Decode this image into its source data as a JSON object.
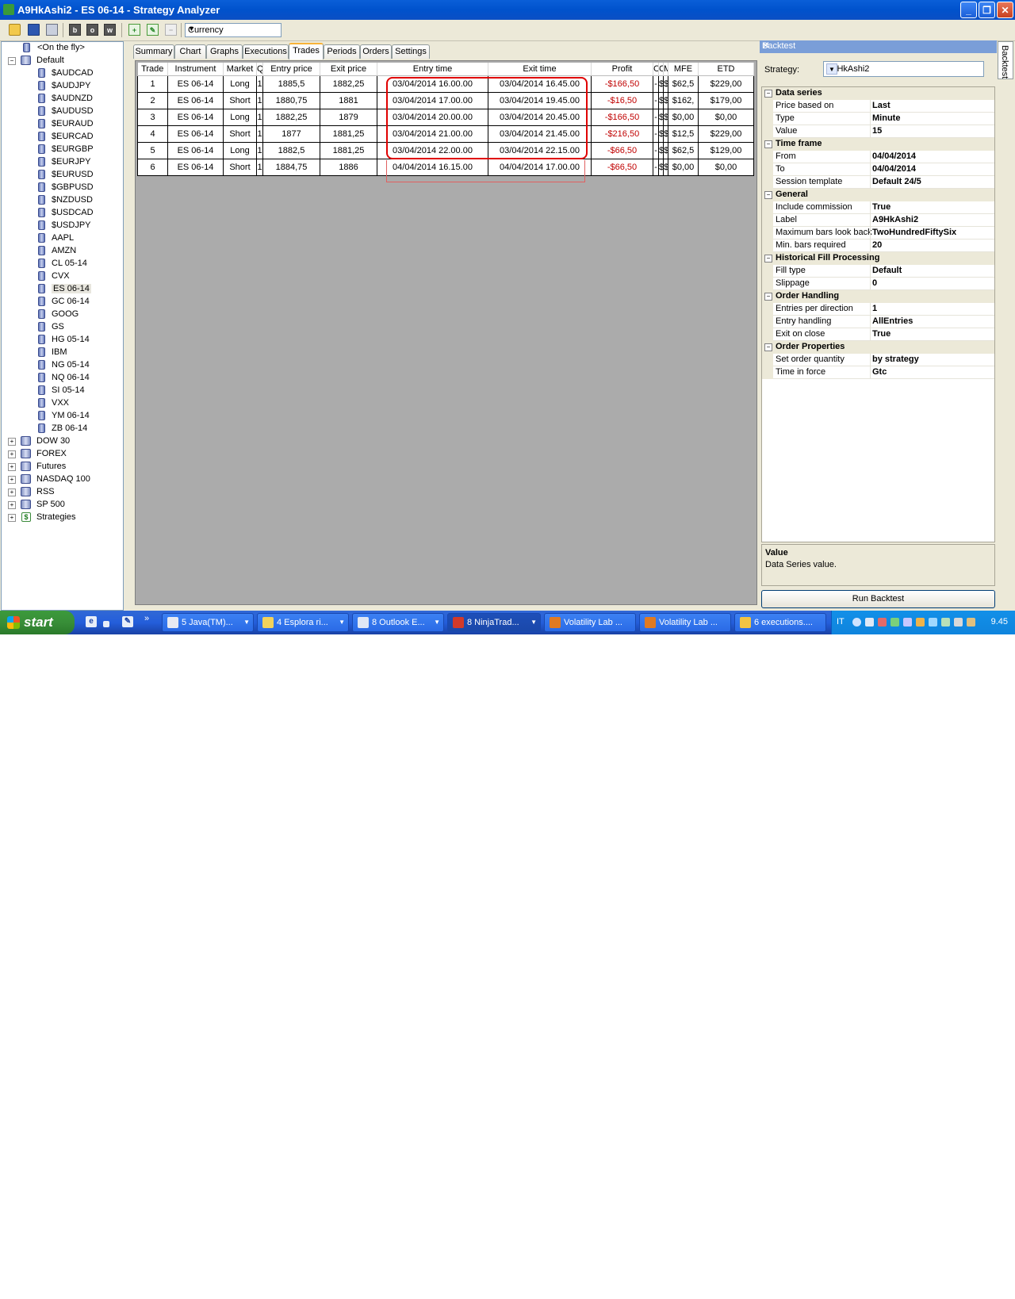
{
  "window": {
    "title": "A9HkAshi2 - ES 06-14 - Strategy Analyzer",
    "min_label": "_",
    "max_label": "❐",
    "close_label": "✕"
  },
  "toolbar": {
    "icons": [
      "open-folder-icon",
      "save-icon",
      "print-icon",
      "b-icon",
      "o-icon",
      "w-icon",
      "add-icon",
      "edit-icon",
      "remove-icon"
    ],
    "b_label": "b",
    "o_label": "o",
    "w_label": "w",
    "display_unit": "Currency"
  },
  "tree": {
    "on_the_fly": "<On the fly>",
    "default_label": "Default",
    "instruments": [
      "$AUDCAD",
      "$AUDJPY",
      "$AUDNZD",
      "$AUDUSD",
      "$EURAUD",
      "$EURCAD",
      "$EURGBP",
      "$EURJPY",
      "$EURUSD",
      "$GBPUSD",
      "$NZDUSD",
      "$USDCAD",
      "$USDJPY",
      "AAPL",
      "AMZN",
      "CL 05-14",
      "CVX",
      "ES 06-14",
      "GC 06-14",
      "GOOG",
      "GS",
      "HG 05-14",
      "IBM",
      "NG 05-14",
      "NQ 06-14",
      "SI 05-14",
      "VXX",
      "YM 06-14",
      "ZB 06-14"
    ],
    "selected": "ES 06-14",
    "groups": [
      "DOW 30",
      "FOREX",
      "Futures",
      "NASDAQ 100",
      "RSS",
      "SP 500",
      "Strategies"
    ],
    "strategies_icon": "$"
  },
  "tabs": [
    "Summary",
    "Chart",
    "Graphs",
    "Executions",
    "Trades",
    "Periods",
    "Orders",
    "Settings"
  ],
  "active_tab": "Trades",
  "trades": {
    "columns": [
      "Trade",
      "Instrument",
      "Market",
      "Q",
      "Entry price",
      "Exit price",
      "Entry time",
      "Exit time",
      "Profit",
      "C",
      "C",
      "M",
      "MFE",
      "ETD"
    ],
    "rows": [
      [
        "1",
        "ES 06-14",
        "Long",
        "1",
        "1885,5",
        "1882,25",
        "03/04/2014 16.00.00",
        "03/04/2014 16.45.00",
        "-$166,50",
        "-",
        "$",
        "$",
        "$62,5",
        "$229,00"
      ],
      [
        "2",
        "ES 06-14",
        "Short",
        "1",
        "1880,75",
        "1881",
        "03/04/2014 17.00.00",
        "03/04/2014 19.45.00",
        "-$16,50",
        "-",
        "$",
        "$",
        "$162,",
        "$179,00"
      ],
      [
        "3",
        "ES 06-14",
        "Long",
        "1",
        "1882,25",
        "1879",
        "03/04/2014 20.00.00",
        "03/04/2014 20.45.00",
        "-$166,50",
        "-",
        "$",
        "$",
        "$0,00",
        "$0,00"
      ],
      [
        "4",
        "ES 06-14",
        "Short",
        "1",
        "1877",
        "1881,25",
        "03/04/2014 21.00.00",
        "03/04/2014 21.45.00",
        "-$216,50",
        "-",
        "$",
        "$",
        "$12,5",
        "$229,00"
      ],
      [
        "5",
        "ES 06-14",
        "Long",
        "1",
        "1882,5",
        "1881,25",
        "03/04/2014 22.00.00",
        "03/04/2014 22.15.00",
        "-$66,50",
        "-",
        "$",
        "$",
        "$62,5",
        "$129,00"
      ],
      [
        "6",
        "ES 06-14",
        "Short",
        "1",
        "1884,75",
        "1886",
        "04/04/2014 16.15.00",
        "04/04/2014 17.00.00",
        "-$66,50",
        "-",
        "$",
        "$",
        "$0,00",
        "$0,00"
      ]
    ]
  },
  "panel": {
    "title": "Backtest",
    "side_tab": "Backtest",
    "strategy_label": "Strategy:",
    "strategy_value": "A9HkAshi2",
    "sections": [
      {
        "name": "Data series",
        "props": [
          [
            "Price based on",
            "Last"
          ],
          [
            "Type",
            "Minute"
          ],
          [
            "Value",
            "15"
          ]
        ]
      },
      {
        "name": "Time frame",
        "props": [
          [
            "From",
            "04/04/2014"
          ],
          [
            "To",
            "04/04/2014"
          ],
          [
            "Session template",
            "Default 24/5"
          ]
        ]
      },
      {
        "name": "General",
        "props": [
          [
            "Include commission",
            "True"
          ],
          [
            "Label",
            "A9HkAshi2"
          ],
          [
            "Maximum bars look back",
            "TwoHundredFiftySix"
          ],
          [
            "Min. bars required",
            "20"
          ]
        ]
      },
      {
        "name": "Historical Fill Processing",
        "props": [
          [
            "Fill type",
            "Default"
          ],
          [
            "Slippage",
            "0"
          ]
        ]
      },
      {
        "name": "Order Handling",
        "props": [
          [
            "Entries per direction",
            "1"
          ],
          [
            "Entry handling",
            "AllEntries"
          ],
          [
            "Exit on close",
            "True"
          ]
        ]
      },
      {
        "name": "Order Properties",
        "props": [
          [
            "Set order quantity",
            "by strategy"
          ],
          [
            "Time in force",
            "Gtc"
          ]
        ]
      }
    ],
    "desc_title": "Value",
    "desc_text": "Data Series value.",
    "run_button": "Run Backtest"
  },
  "taskbar": {
    "start": "start",
    "quick_more": "»",
    "buttons": [
      {
        "label": "5 Java(TM)...",
        "color": "#e8eaf2"
      },
      {
        "label": "4 Esplora ri...",
        "color": "#f3d25b"
      },
      {
        "label": "8 Outlook E...",
        "color": "#dfe7f5"
      },
      {
        "label": "8 NinjaTrad...",
        "color": "#d23a2a"
      },
      {
        "label": "Volatility Lab ...",
        "color": "#e07a22"
      },
      {
        "label": "Volatility Lab ...",
        "color": "#e07a22"
      },
      {
        "label": "6 executions....",
        "color": "#f1c343"
      }
    ],
    "active_index": 3,
    "lang": "IT",
    "clock": "9.45"
  }
}
